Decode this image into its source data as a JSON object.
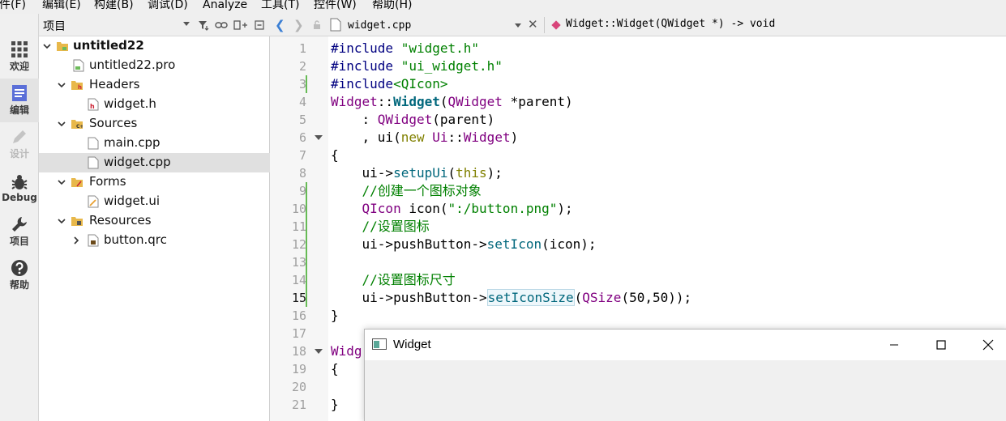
{
  "menu": [
    "文件(F)",
    "编辑(E)",
    "构建(B)",
    "调试(D)",
    "Analyze",
    "工具(T)",
    "控件(W)",
    "帮助(H)"
  ],
  "modes": [
    {
      "label": "欢迎",
      "icon": "grid-icon"
    },
    {
      "label": "编辑",
      "icon": "edit-document-icon"
    },
    {
      "label": "设计",
      "icon": "pencil-icon"
    },
    {
      "label": "Debug",
      "icon": "bug-icon"
    },
    {
      "label": "项目",
      "icon": "wrench-icon"
    },
    {
      "label": "帮助",
      "icon": "question-icon"
    }
  ],
  "project_panel": {
    "title": "项目",
    "tree": [
      {
        "label": "untitled22",
        "level": 0,
        "expanded": true,
        "icon": "project-folder-icon",
        "bold": true
      },
      {
        "label": "untitled22.pro",
        "level": 1,
        "icon": "pro-file-icon"
      },
      {
        "label": "Headers",
        "level": 1,
        "expanded": true,
        "icon": "headers-folder-icon"
      },
      {
        "label": "widget.h",
        "level": 2,
        "icon": "header-file-icon"
      },
      {
        "label": "Sources",
        "level": 1,
        "expanded": true,
        "icon": "sources-folder-icon"
      },
      {
        "label": "main.cpp",
        "level": 2,
        "icon": "cpp-file-icon"
      },
      {
        "label": "widget.cpp",
        "level": 2,
        "icon": "cpp-file-icon",
        "selected": true
      },
      {
        "label": "Forms",
        "level": 1,
        "expanded": true,
        "icon": "forms-folder-icon"
      },
      {
        "label": "widget.ui",
        "level": 2,
        "icon": "ui-file-icon"
      },
      {
        "label": "Resources",
        "level": 1,
        "expanded": true,
        "icon": "resources-folder-icon"
      },
      {
        "label": "button.qrc",
        "level": 2,
        "expanded": false,
        "icon": "qrc-file-icon"
      }
    ]
  },
  "editor_toolbar": {
    "file": "widget.cpp",
    "signature": "Widget::Widget(QWidget *) -> void"
  },
  "editor": {
    "current_line": 15,
    "lines": [
      [
        [
          "m",
          "#include "
        ],
        [
          "s",
          "\"widget.h\""
        ]
      ],
      [
        [
          "m",
          "#include "
        ],
        [
          "s",
          "\"ui_widget.h\""
        ]
      ],
      [
        [
          "m",
          "#include"
        ],
        [
          "s",
          "<QIcon>"
        ]
      ],
      [
        [
          "t",
          "Widget"
        ],
        [
          "p",
          "::"
        ],
        [
          "fb",
          "Widget"
        ],
        [
          "p",
          "("
        ],
        [
          "t",
          "QWidget"
        ],
        [
          "p",
          " *parent)"
        ]
      ],
      [
        [
          "p",
          "    : "
        ],
        [
          "t",
          "QWidget"
        ],
        [
          "p",
          "(parent)"
        ]
      ],
      [
        [
          "p",
          "    , ui("
        ],
        [
          "k",
          "new"
        ],
        [
          "p",
          " "
        ],
        [
          "t",
          "Ui"
        ],
        [
          "p",
          "::"
        ],
        [
          "t",
          "Widget"
        ],
        [
          "p",
          ")"
        ]
      ],
      [
        [
          "p",
          "{"
        ]
      ],
      [
        [
          "p",
          "    ui->"
        ],
        [
          "f",
          "setupUi"
        ],
        [
          "p",
          "("
        ],
        [
          "k",
          "this"
        ],
        [
          "p",
          ");"
        ]
      ],
      [
        [
          "c",
          "    //创建一个图标对象"
        ]
      ],
      [
        [
          "p",
          "    "
        ],
        [
          "t",
          "QIcon"
        ],
        [
          "p",
          " icon("
        ],
        [
          "s",
          "\":/button.png\""
        ],
        [
          "p",
          ");"
        ]
      ],
      [
        [
          "c",
          "    //设置图标"
        ]
      ],
      [
        [
          "p",
          "    ui->pushButton->"
        ],
        [
          "f",
          "setIcon"
        ],
        [
          "p",
          "(icon);"
        ]
      ],
      [
        [
          "p",
          ""
        ]
      ],
      [
        [
          "c",
          "    //设置图标尺寸"
        ]
      ],
      [
        [
          "p",
          "    ui->pushButton->"
        ],
        [
          "fh",
          "setIconSize"
        ],
        [
          "p",
          "("
        ],
        [
          "t",
          "QSize"
        ],
        [
          "p",
          "(50,50));"
        ]
      ],
      [
        [
          "p",
          "}"
        ]
      ],
      [
        [
          "p",
          ""
        ]
      ],
      [
        [
          "t",
          "Widg"
        ]
      ],
      [
        [
          "p",
          "{"
        ]
      ],
      [
        [
          "p",
          ""
        ]
      ],
      [
        [
          "p",
          "}"
        ]
      ]
    ]
  },
  "widget_window": {
    "title": "Widget"
  },
  "colors": {
    "keyword": "#808000",
    "string": "#008000",
    "type": "#800080",
    "function": "#00677c",
    "comment": "#008000",
    "change_marker": "#66bb55"
  }
}
